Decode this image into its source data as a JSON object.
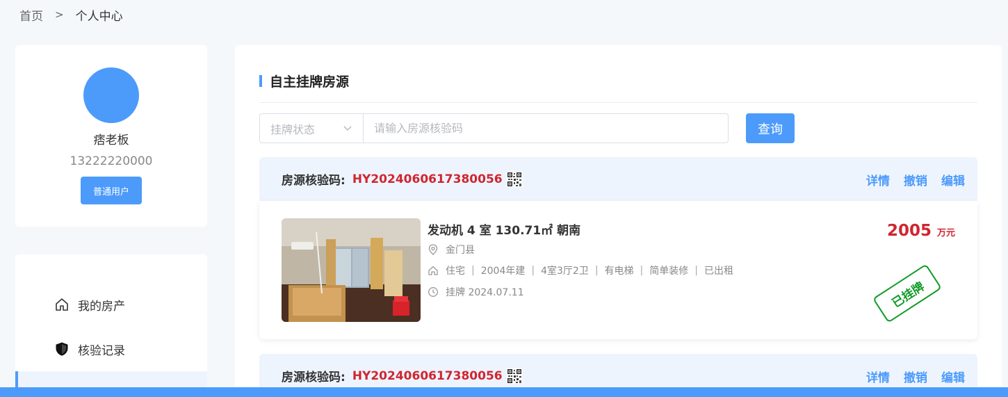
{
  "breadcrumb": {
    "home": "首页",
    "separator": ">",
    "current": "个人中心"
  },
  "profile": {
    "name": "痞老板",
    "phone": "13222220000",
    "role": "普通用户"
  },
  "menu": {
    "items": [
      {
        "label": "我的房产",
        "icon": "home-outline-icon"
      },
      {
        "label": "核验记录",
        "icon": "shield-icon"
      },
      {
        "label": "",
        "icon": "list-icon"
      }
    ]
  },
  "section": {
    "title": "自主挂牌房源"
  },
  "filter": {
    "status_placeholder": "挂牌状态",
    "code_placeholder": "请输入房源核验码",
    "query_label": "查询"
  },
  "listings": [
    {
      "code_label": "房源核验码:",
      "code": "HY2024060617380056",
      "actions": [
        "详情",
        "撤销",
        "编辑"
      ],
      "title": "发动机 4 室 130.71㎡ 朝南",
      "location": "金门县",
      "tags": [
        "住宅",
        "2004年建",
        "4室3厅2卫",
        "有电梯",
        "简单装修",
        "已出租"
      ],
      "listed": "挂牌 2024.07.11",
      "price": "2005",
      "price_unit": "万元",
      "status": "已挂牌"
    },
    {
      "code_label": "房源核验码:",
      "code": "HY2024060617380056",
      "actions": [
        "详情",
        "撤销",
        "编辑"
      ]
    }
  ],
  "colors": {
    "accent": "#4c9bfb",
    "price": "#d0262f",
    "stamp": "#119a28",
    "panel_bg": "#eef4fe"
  }
}
